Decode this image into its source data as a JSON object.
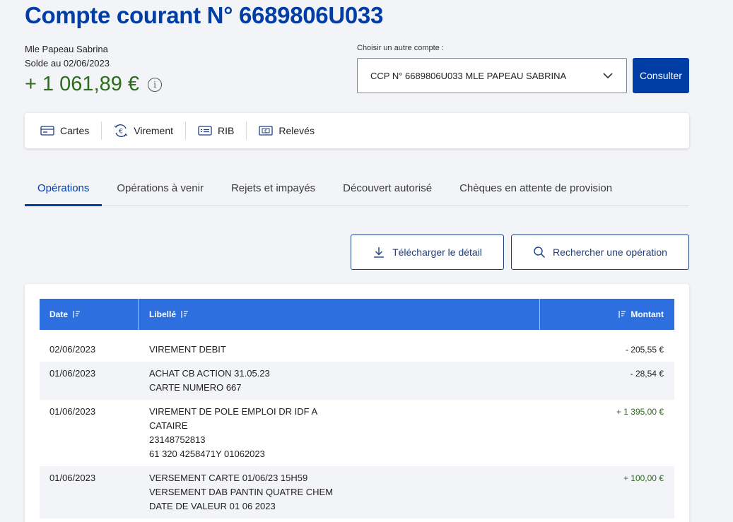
{
  "header": {
    "title": "Compte courant N° 6689806U033",
    "holder": "Mle Papeau Sabrina",
    "solde_label": "Solde au 02/06/2023",
    "balance": "+ 1 061,89 €",
    "info_icon": "info-icon"
  },
  "account_switch": {
    "label": "Choisir un autre compte :",
    "selected": "CCP N° 6689806U033 MLE PAPEAU SABRINA",
    "button": "Consulter"
  },
  "actions": [
    {
      "label": "Cartes",
      "icon": "card-icon"
    },
    {
      "label": "Virement",
      "icon": "transfer-icon"
    },
    {
      "label": "RIB",
      "icon": "rib-icon"
    },
    {
      "label": "Relevés",
      "icon": "statement-icon"
    }
  ],
  "tabs": [
    {
      "label": "Opérations",
      "active": true
    },
    {
      "label": "Opérations à venir",
      "active": false
    },
    {
      "label": "Rejets et impayés",
      "active": false
    },
    {
      "label": "Découvert autorisé",
      "active": false
    },
    {
      "label": "Chèques en attente de provision",
      "active": false
    }
  ],
  "toolbar": {
    "download_label": "Télécharger le détail",
    "search_label": "Rechercher une opération"
  },
  "table": {
    "columns": {
      "date": "Date",
      "libelle": "Libellé",
      "montant": "Montant"
    },
    "rows": [
      {
        "date": "02/06/2023",
        "libelle": [
          "VIREMENT DEBIT"
        ],
        "montant": "- 205,55 €",
        "sign": "neg"
      },
      {
        "date": "01/06/2023",
        "libelle": [
          "ACHAT CB ACTION 31.05.23",
          "CARTE NUMERO 667"
        ],
        "montant": "- 28,54 €",
        "sign": "neg"
      },
      {
        "date": "01/06/2023",
        "libelle": [
          "VIREMENT DE POLE EMPLOI DR IDF A",
          "CATAIRE",
          "23148752813",
          "61 320 4258471Y 01062023"
        ],
        "montant": "+ 1 395,00 €",
        "sign": "pos"
      },
      {
        "date": "01/06/2023",
        "libelle": [
          "VERSEMENT CARTE 01/06/23 15H59",
          "VERSEMENT DAB PANTIN QUATRE CHEM",
          "DATE DE VALEUR 01 06 2023"
        ],
        "montant": "+ 100,00 €",
        "sign": "pos"
      }
    ]
  },
  "colors": {
    "brand": "#003da5",
    "header_blue": "#2e6fe0",
    "positive": "#2e6b1c"
  }
}
